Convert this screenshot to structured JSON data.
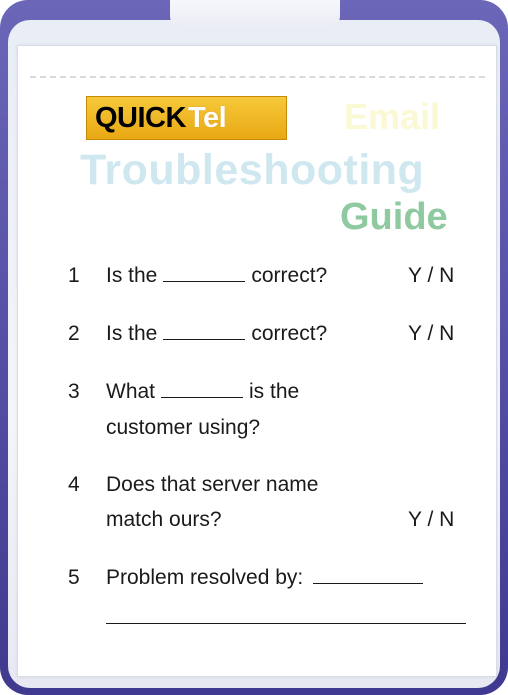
{
  "logo": {
    "quick": "QUICK",
    "tel": "Tel"
  },
  "title": {
    "email": "Email",
    "troubleshooting": "Troubleshooting",
    "guide": "Guide"
  },
  "items": [
    {
      "num": "1",
      "before": "Is the",
      "after": "correct?",
      "yn": "Y / N"
    },
    {
      "num": "2",
      "before": "Is the",
      "after": "correct?",
      "yn": "Y / N"
    },
    {
      "num": "3",
      "line1_before": "What",
      "line1_after": "is the",
      "line2": "customer using?"
    },
    {
      "num": "4",
      "line1": "Does that server name",
      "line2": "match ours?",
      "yn": "Y / N"
    },
    {
      "num": "5",
      "text": "Problem resolved by:"
    }
  ],
  "colors": {
    "frame": "#4a459a",
    "logo_bg": "#f2b824",
    "email": "#fbf8d4",
    "troubleshooting": "#cfe8ef",
    "guide": "#8fc9a0"
  }
}
